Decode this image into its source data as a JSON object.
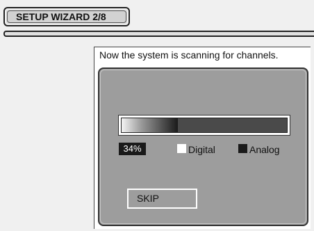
{
  "header": {
    "title": "SETUP WIZARD 2/8"
  },
  "panel": {
    "message": "Now the system is scanning for channels."
  },
  "scan": {
    "progress_percent": 34,
    "progress_label": "34%",
    "legend": {
      "digital_label": "Digital",
      "analog_label": "Analog",
      "digital_color": "#ffffff",
      "analog_color": "#1a1a1a"
    }
  },
  "actions": {
    "skip_label": "SKIP"
  },
  "colors": {
    "background": "#f0f0f0",
    "panel_background": "#ffffff",
    "inner_box": "#9d9d9d",
    "progress_track": "#4a4a4a"
  }
}
